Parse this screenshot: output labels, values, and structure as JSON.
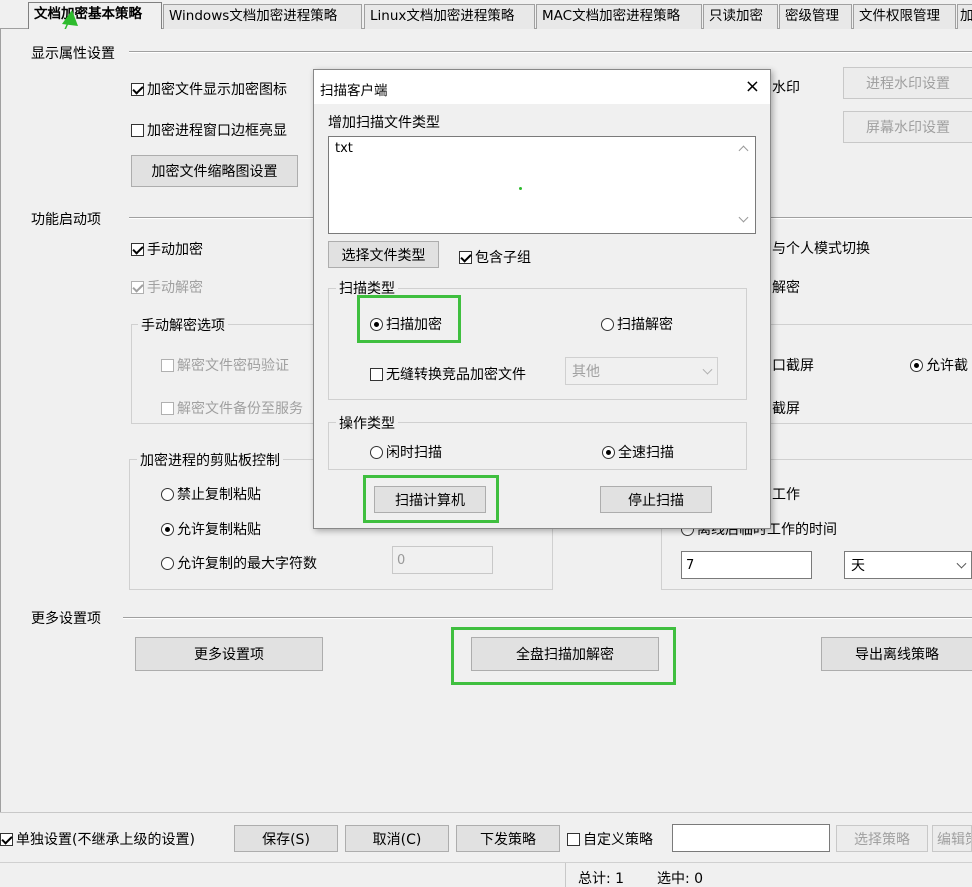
{
  "tabs": [
    "文档加密基本策略",
    "Windows文档加密进程策略",
    "Linux文档加密进程策略",
    "MAC文档加密进程策略",
    "只读加密",
    "密级管理",
    "文件权限管理",
    "加"
  ],
  "display": {
    "title": "显示属性设置",
    "show_icon": "加密文件显示加密图标",
    "border_highlight": "加密进程窗口边框亮显",
    "thumbnail_btn": "加密文件缩略图设置",
    "watermark_label": "水印",
    "process_watermark_btn": "进程水印设置",
    "screen_watermark_btn": "屏幕水印设置"
  },
  "func": {
    "title": "功能启动项",
    "manual_encrypt": "手动加密",
    "manual_decrypt": "手动解密",
    "personal_mode": "与个人模式切换",
    "decrypt_right": "解密",
    "decrypt_options": {
      "title": "手动解密选项",
      "pwd_verify": "解密文件密码验证",
      "backup": "解密文件备份至服务"
    },
    "screenshot_right1": "口截屏",
    "allow_right": "允许截",
    "screenshot_right2": "截屏",
    "clipboard": {
      "title": "加密进程的剪贴板控制",
      "forbid": "禁止复制粘贴",
      "allow": "允许复制粘贴",
      "max_chars": "允许复制的最大字符数",
      "max_value": "0"
    },
    "offline": {
      "work_label": "工作",
      "time_label": "离线后临时工作的时间",
      "time_value": "7",
      "unit": "天"
    }
  },
  "more": {
    "title": "更多设置项",
    "more_btn": "更多设置项",
    "full_scan_btn": "全盘扫描加解密",
    "export_btn": "导出离线策略"
  },
  "bottom": {
    "standalone": "单独设置(不继承上级的设置)",
    "save_btn": "保存(S)",
    "cancel_btn": "取消(C)",
    "issue_btn": "下发策略",
    "custom_policy": "自定义策略",
    "choose_policy_btn": "选择策略",
    "edit_btn": "编辑策"
  },
  "status": {
    "total": "总计: 1",
    "selected": "选中: 0"
  },
  "dialog": {
    "title": "扫描客户端",
    "close": "×",
    "add_type_label": "增加扫描文件类型",
    "types_value": "txt",
    "choose_type_btn": "选择文件类型",
    "include_sub": "包含子组",
    "scan_type": {
      "title": "扫描类型",
      "encrypt": "扫描加密",
      "decrypt": "扫描解密",
      "seamless": "无缝转换竞品加密文件",
      "other_select": "其他"
    },
    "op_type": {
      "title": "操作类型",
      "idle": "闲时扫描",
      "full_speed": "全速扫描"
    },
    "scan_computer_btn": "扫描计算机",
    "stop_btn": "停止扫描"
  },
  "colors": {
    "highlight": "#3fbf3f",
    "arrow": "#2dbb2d"
  }
}
